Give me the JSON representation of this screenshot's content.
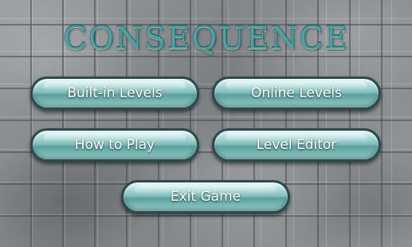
{
  "title": "CONSEQUENCE",
  "menu": {
    "built_in_levels": "Built-in Levels",
    "online_levels": "Online Levels",
    "how_to_play": "How to Play",
    "level_editor": "Level Editor",
    "exit_game": "Exit Game"
  },
  "colors": {
    "accent": "#4aa7a8",
    "button_border": "#2c4a4c",
    "background": "#8e9294"
  }
}
